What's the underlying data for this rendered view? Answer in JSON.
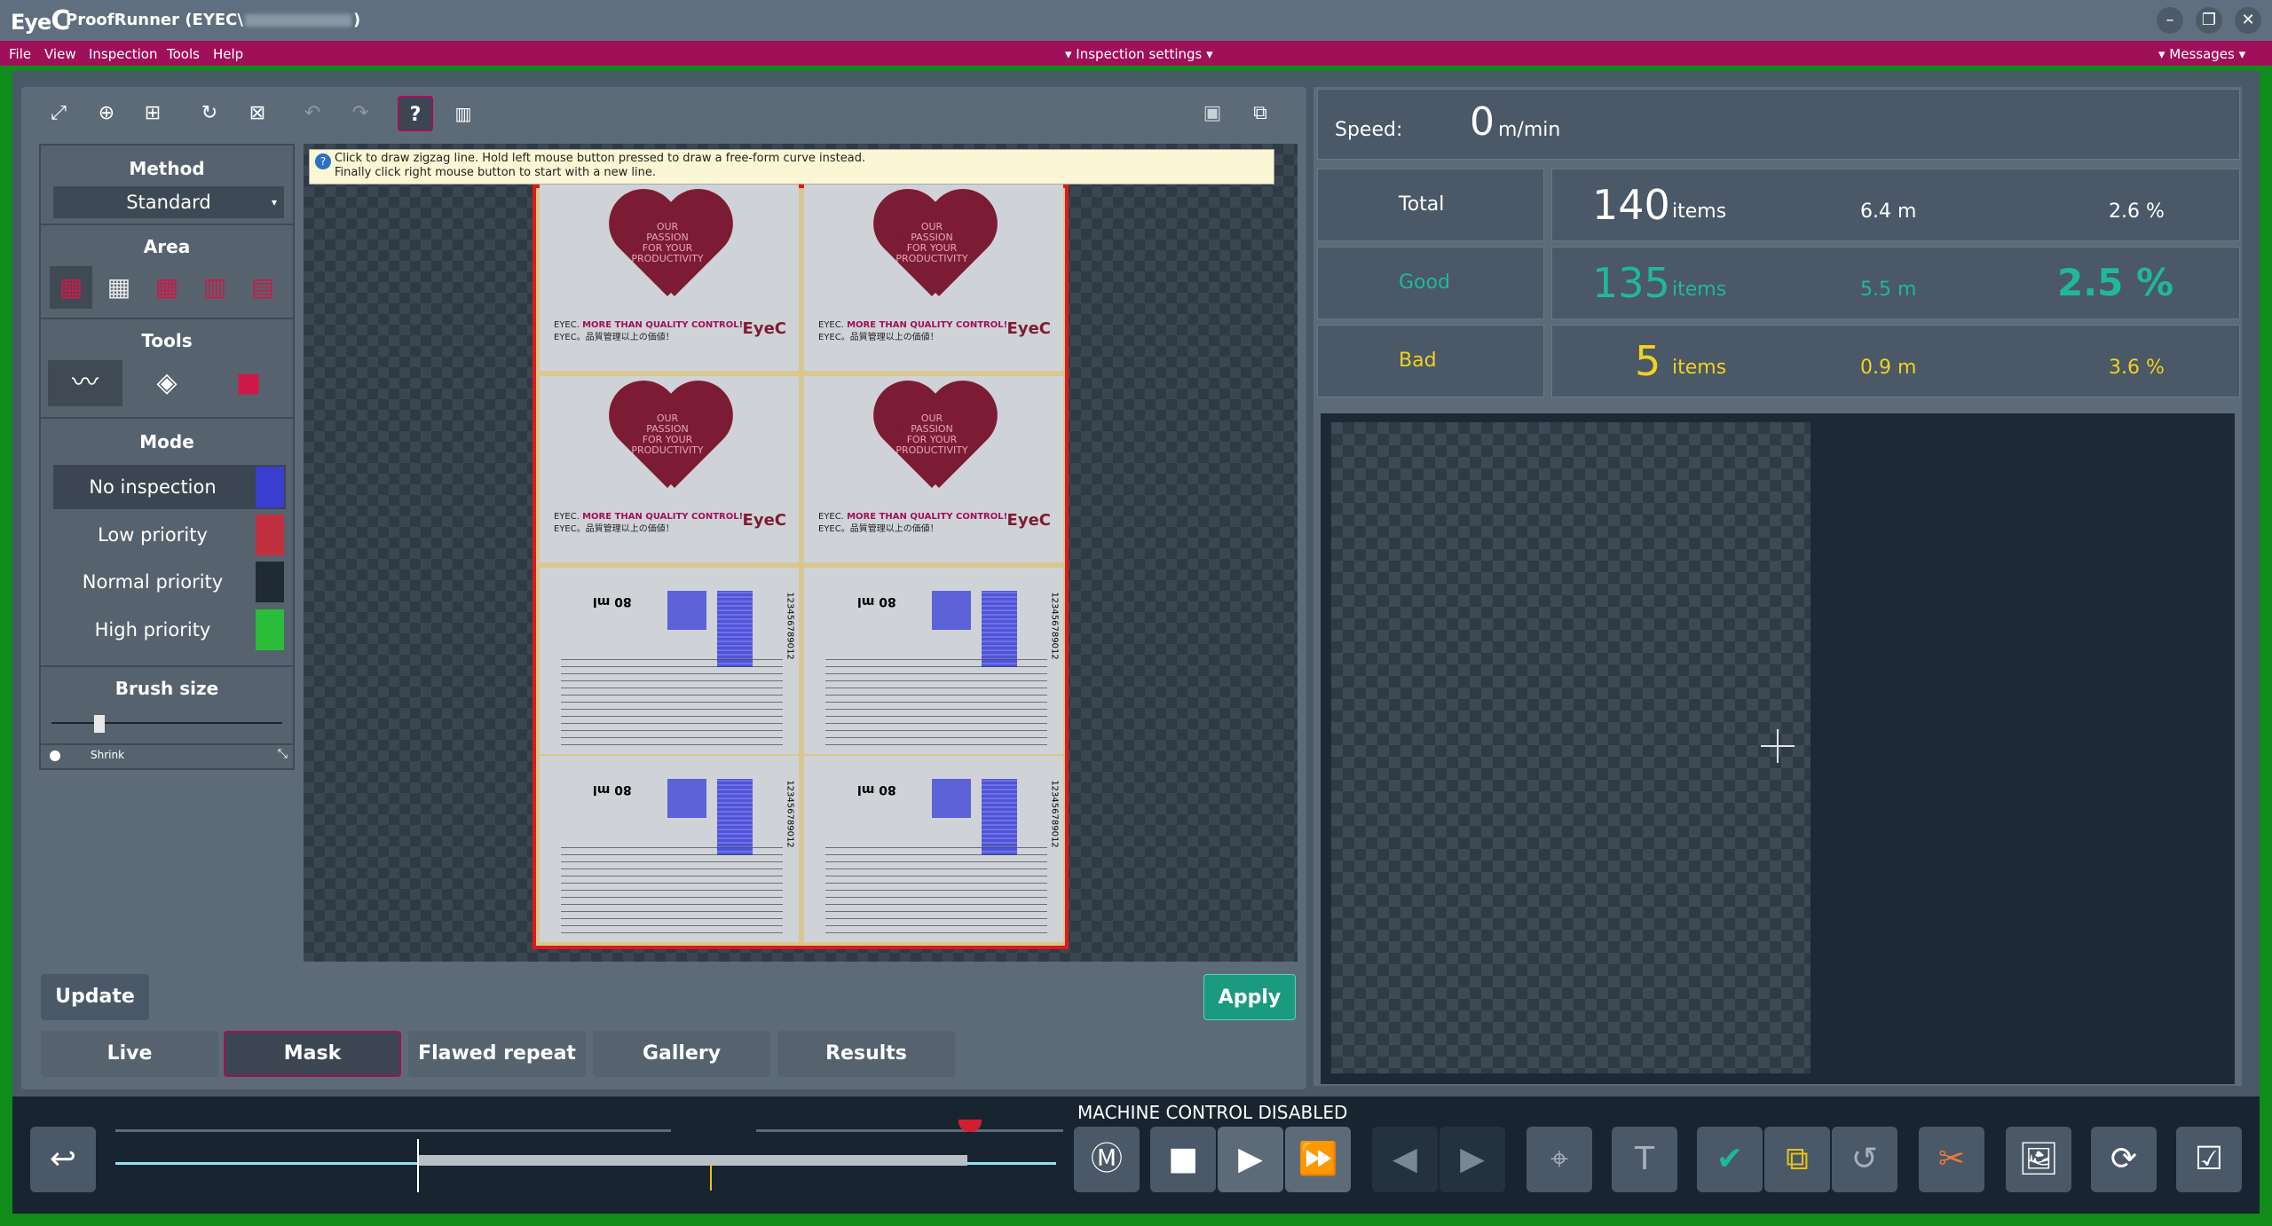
{
  "window": {
    "app": "ProofRunner",
    "title_prefix": "(EYEC\\",
    "title_suffix": ")"
  },
  "menu": {
    "file": "File",
    "view": "View",
    "inspection": "Inspection",
    "tools": "Tools",
    "help": "Help",
    "center": "▾ Inspection settings ▾",
    "right": "▾ Messages ▾"
  },
  "side": {
    "method_title": "Method",
    "method_value": "Standard",
    "area_title": "Area",
    "tools_title": "Tools",
    "mode_title": "Mode",
    "modes": [
      {
        "label": "No inspection",
        "color": "#3a3ed0"
      },
      {
        "label": "Low priority",
        "color": "#c0303f"
      },
      {
        "label": "Normal priority",
        "color": "#1f2a34"
      },
      {
        "label": "High priority",
        "color": "#2bbd3a"
      }
    ],
    "brush_title": "Brush size",
    "shrink": "Shrink"
  },
  "hint": {
    "line1": "Click to draw zigzag line. Hold left mouse button pressed to draw a free-form curve instead.",
    "line2": "Finally click right mouse button to start with a new line."
  },
  "labels": {
    "passion_l1": "OUR",
    "passion_l2": "PASSION",
    "passion_l3": "FOR YOUR",
    "passion_l4": "PRODUCTIVITY",
    "slogan_a": "EYEC.",
    "slogan_b": "MORE THAN QUALITY CONTROL!",
    "slogan_c": "EYEC。品質管理以上の価値！",
    "logo": "EyeC",
    "volume": "80 ml",
    "barcode": "123456789012"
  },
  "buttons": {
    "update": "Update",
    "apply": "Apply"
  },
  "tabs": [
    "Live",
    "Mask",
    "Flawed repeat",
    "Gallery",
    "Results"
  ],
  "stats": {
    "speed_label": "Speed:",
    "speed_value": "0",
    "speed_unit": "m/min",
    "rows": [
      {
        "label": "Total",
        "count": "140",
        "unit": "items",
        "length": "6.4 m",
        "percent": "2.6 %",
        "color": "#ffffff"
      },
      {
        "label": "Good",
        "count": "135",
        "unit": "items",
        "length": "5.5 m",
        "percent": "2.5 %",
        "color": "#1fb99a"
      },
      {
        "label": "Bad",
        "count": "5",
        "unit": "items",
        "length": "0.9 m",
        "percent": "3.6 %",
        "color": "#f2d21e"
      }
    ]
  },
  "machine": {
    "status": "MACHINE CONTROL DISABLED"
  },
  "colors": {
    "accent": "#a0105a",
    "frame": "#0f8c19",
    "good": "#1fb99a",
    "bad": "#f2d21e"
  }
}
